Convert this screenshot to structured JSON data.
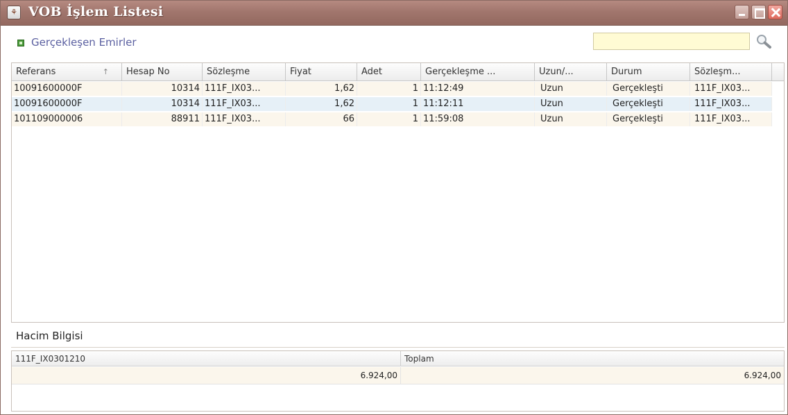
{
  "window": {
    "title": "VOB İşlem Listesi",
    "app_icon": "app-icon",
    "controls": {
      "minimize": "minimize-icon",
      "maximize": "maximize-icon",
      "close": "close-icon"
    }
  },
  "section": {
    "label": "Gerçekleşen Emirler",
    "icon": "green-square-icon"
  },
  "search": {
    "value": "",
    "placeholder": "",
    "icon": "search-icon"
  },
  "orders_table": {
    "columns": [
      "Referans",
      "Hesap No",
      "Sözleşme",
      "Fiyat",
      "Adet",
      "Gerçekleşme ...",
      "Uzun/...",
      "Durum",
      "Sözleşm..."
    ],
    "sort_indicator": "↑",
    "rows": [
      [
        "10091600000F",
        "10314",
        "111F_IX03...",
        "1,62",
        "1",
        "11:12:49",
        "Uzun",
        "Gerçekleşti",
        "111F_IX03..."
      ],
      [
        "10091600000F",
        "10314",
        "111F_IX03...",
        "1,62",
        "1",
        "11:12:11",
        "Uzun",
        "Gerçekleşti",
        "111F_IX03..."
      ],
      [
        "101109000006",
        "88911",
        "111F_IX03...",
        "66",
        "1",
        "11:59:08",
        "Uzun",
        "Gerçekleşti",
        "111F_IX03..."
      ]
    ]
  },
  "volume": {
    "title": "Hacim Bilgisi",
    "columns": [
      "111F_IX0301210",
      "Toplam"
    ],
    "values": [
      "6.924,00",
      "6.924,00"
    ]
  },
  "colors": {
    "titlebar": "#a1766d",
    "row_alt": "#fbf6ec",
    "row_selected": "#e6f0f7",
    "search_bg": "#fffbd4",
    "section_label": "#5a5fa0"
  }
}
